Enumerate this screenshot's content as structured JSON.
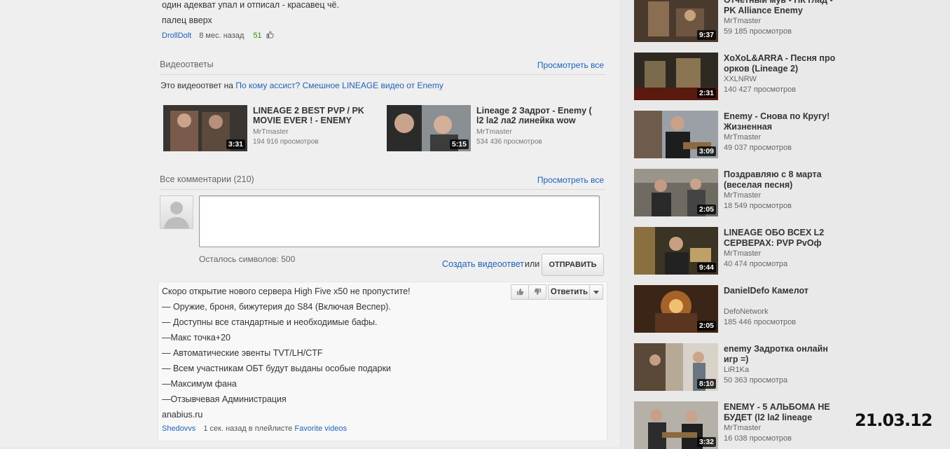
{
  "top_comment": {
    "lines": [
      "один адекват упал и отписал - красавец чё.",
      "палец вверх"
    ],
    "user": "DrollDolt",
    "time": "8 мес. назад",
    "likes": "51"
  },
  "video_responses": {
    "title": "Видеоответы",
    "view_all": "Просмотреть все",
    "response_prefix": "Это видеоответ на",
    "response_link": "По кому ассист? Смешное LINEAGE видео от Enemy",
    "items": [
      {
        "title": "LINEAGE 2 BEST PVP / PK MOVIE EVER ! - ENEMY",
        "owner": "MrTmaster",
        "views": "194 916 просмотров",
        "duration": "3:31"
      },
      {
        "title": "Lineage 2 Задрот - Enemy ( l2 la2 ла2 линейка wow",
        "owner": "MrTmaster",
        "views": "534 436 просмотров",
        "duration": "5:15"
      }
    ]
  },
  "comments": {
    "title": "Все комментарии (210)",
    "view_all": "Просмотреть все",
    "chars_left": "Осталось символов: 500",
    "create_video_response": "Создать видеоответ",
    "or": "или",
    "send": "ОТПРАВИТЬ",
    "reply": "Ответить",
    "item": {
      "lines": [
        "Скоро открытие нового сервера High Five x50 не пропустите!",
        "— Оружие, броня, бижутерия до S84 (Включая Веспер).",
        "— Доступны все стандартные и необходимые бафы.",
        "—Макс точка+20",
        "— Автоматические эвенты TVT/LH/CTF",
        "— Всем участникам ОБТ будут выданы особые подарки",
        "—Максимум фана",
        "—Отзывчевая Администрация",
        "anabius.ru"
      ],
      "user": "Shedovvs",
      "time": "1 сек. назад в плейлисте",
      "playlist": "Favorite videos"
    }
  },
  "sidebar": {
    "items": [
      {
        "title": "Отчетный мув - ПК глад - PK Alliance Enemy",
        "owner": "MrTmaster",
        "views": "59 185 просмотров",
        "duration": "9:37"
      },
      {
        "title": "XoXoL&ARRA - Песня про орков (Lineage 2)",
        "owner": "XXLNRW",
        "views": "140 427 просмотров",
        "duration": "2:31"
      },
      {
        "title": "Enemy - Снова по Кругу! Жизненная",
        "owner": "MrTmaster",
        "views": "49 037 просмотров",
        "duration": "3:09"
      },
      {
        "title": "Поздравляю с 8 марта (веселая песня)",
        "owner": "MrTmaster",
        "views": "18 549 просмотров",
        "duration": "2:05"
      },
      {
        "title": "LINEAGE ОБО ВСЕХ L2 СЕРВЕРАХ: PVP PvOф",
        "owner": "MrTmaster",
        "views": "40 474 просмотра",
        "duration": "9:44"
      },
      {
        "title": "DanielDefo Камелот",
        "owner": "DefoNetwork",
        "views": "185 446 просмотров",
        "duration": "2:05"
      },
      {
        "title": "enemy Задротка онлайн игр =)",
        "owner": "LiR1Ka",
        "views": "50 363 просмотра",
        "duration": "8:10"
      },
      {
        "title": "ENEMY - 5 АЛЬБОМА НЕ БУДЕТ (l2 la2 lineage",
        "owner": "MrTmaster",
        "views": "16 038 просмотров",
        "duration": "3:32"
      }
    ]
  },
  "date_stamp": "21.03.12"
}
